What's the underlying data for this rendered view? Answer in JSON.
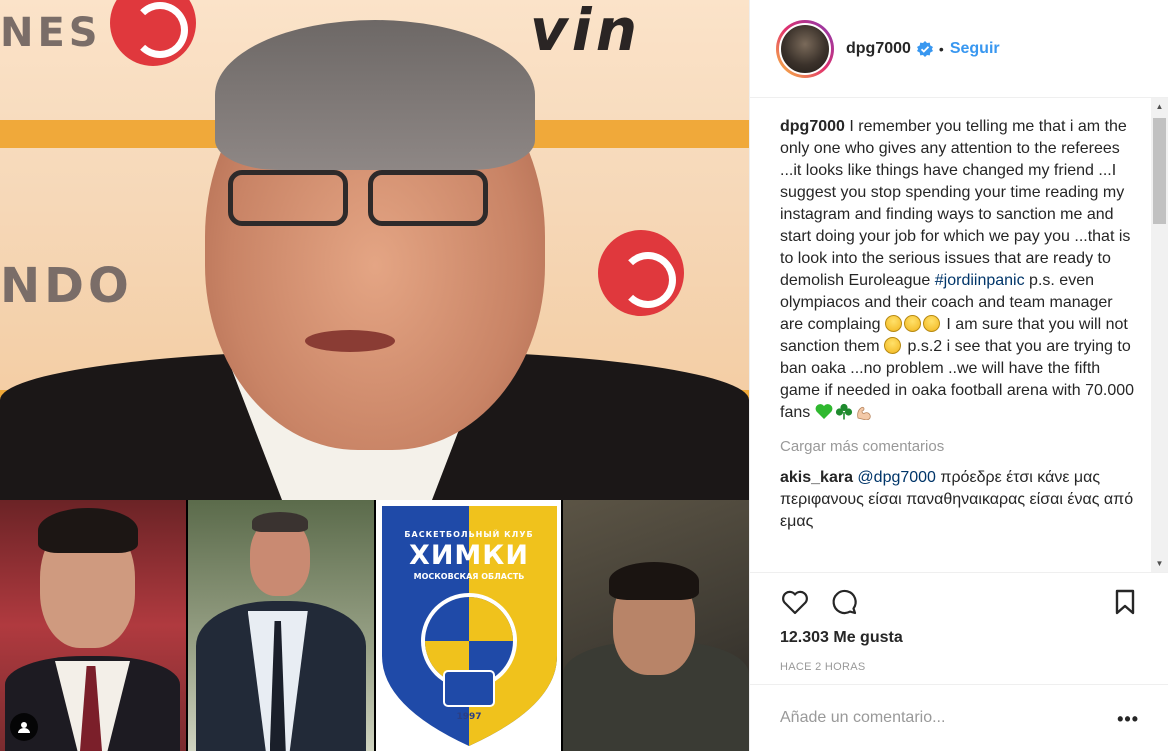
{
  "post": {
    "username": "dpg7000",
    "follow_label": "Seguir",
    "separator": "•"
  },
  "caption": {
    "author": "dpg7000",
    "text_1": " I remember you telling me that i am the only one who gives any attention to the referees ...it looks like things have changed my friend ...I suggest you stop spending your time reading my instagram and finding ways to sanction me and start doing your job for which we pay you ...that is to look into the serious issues that are ready to demolish Euroleague ",
    "hashtag": "#jordiinpanic",
    "text_2": " p.s. even olympiacos and their coach and team manager are complaing ",
    "text_3": " I am sure that you will not sanction them ",
    "text_4": " p.s.2 i see that you are trying to ban oaka ...no problem ..we will have the fifth game if needed in oaka football arena with 70.000 fans "
  },
  "load_more_label": "Cargar más comentarios",
  "comments": [
    {
      "author": "akis_kara",
      "mention": "@dpg7000",
      "text": " πρόεδρε έτσι κάνε μας περιφανους είσαι παναθηναικαρας είσαι ένας από εμας"
    }
  ],
  "stats": {
    "likes_label": "12.303 Me gusta",
    "time_label": "HACE 2 HORAS"
  },
  "add_comment": {
    "placeholder": "Añade un comentario..."
  },
  "media": {
    "khimki_club": "БАСКЕТБОЛЬНЫЙ КЛУБ",
    "khimki_name": "ХИМКИ",
    "khimki_region": "МОСКОВСКАЯ ОБЛАСТЬ",
    "khimki_year": "1997",
    "banner_left": "NES",
    "banner_mid": "NDO",
    "banner_right": "vin"
  },
  "colors": {
    "link_blue": "#3897f0",
    "hashtag_navy": "#003569",
    "muted_gray": "#999999",
    "verified_blue": "#3897f0"
  },
  "icons": [
    "verified-badge-icon",
    "heart-icon",
    "comment-icon",
    "bookmark-icon",
    "more-options-icon",
    "user-tag-icon"
  ]
}
